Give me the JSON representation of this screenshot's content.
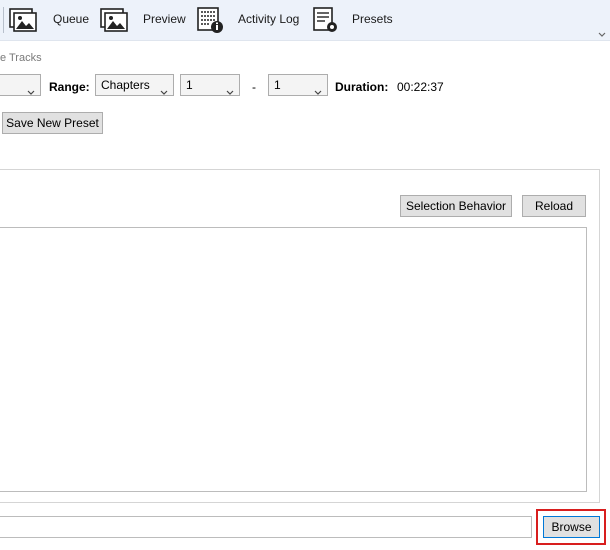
{
  "toolbar": {
    "items": [
      {
        "label": "Queue",
        "icon": "images-icon"
      },
      {
        "label": "Preview",
        "icon": "preview-icon"
      },
      {
        "label": "Activity Log",
        "icon": "activity-log-icon"
      },
      {
        "label": "Presets",
        "icon": "presets-icon"
      }
    ]
  },
  "tracks_label": "e Tracks",
  "source_row": {
    "range_label": "Range:",
    "range_mode": "Chapters",
    "range_start": "1",
    "range_separator": "-",
    "range_end": "1",
    "duration_label": "Duration:",
    "duration_value": "00:22:37"
  },
  "preset": {
    "save_new_label": "Save New Preset"
  },
  "tracks_panel": {
    "selection_behavior_label": "Selection Behavior",
    "reload_label": "Reload"
  },
  "destination": {
    "path_value": "",
    "browse_label": "Browse"
  },
  "colors": {
    "toolbar_bg": "#edf2fa",
    "highlight": "#d81e1e",
    "button_bg": "#e1e1e1"
  }
}
